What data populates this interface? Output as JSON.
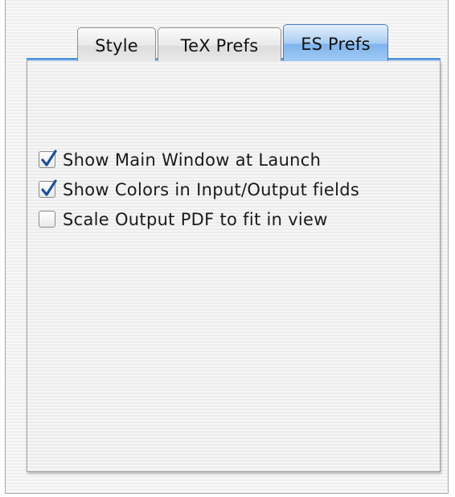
{
  "tabs": [
    {
      "label": "Style",
      "selected": false
    },
    {
      "label": "TeX Prefs",
      "selected": false
    },
    {
      "label": "ES Prefs",
      "selected": true
    }
  ],
  "options": [
    {
      "label": "Show Main Window at Launch",
      "checked": true
    },
    {
      "label": "Show Colors in Input/Output fields",
      "checked": true
    },
    {
      "label": "Scale Output PDF to fit in view",
      "checked": false
    }
  ],
  "colors": {
    "selected_tab": "#7fb3ec",
    "checkmark": "#1e4f9b"
  },
  "icons": {
    "check": "checkmark-icon"
  }
}
